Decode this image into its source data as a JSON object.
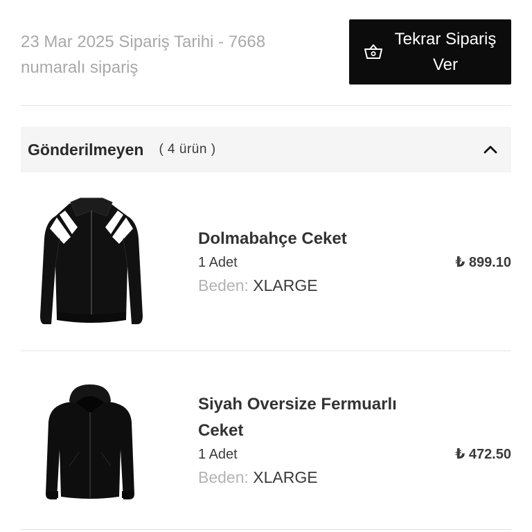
{
  "order": {
    "meta_text": "23 Mar 2025 Sipariş Tarihi - 7668 numaralı sipariş",
    "reorder_label": "Tekrar Sipariş Ver"
  },
  "section": {
    "title": "Gönderilmeyen",
    "count": "( 4 ürün )",
    "toggle_icon": "chevron-up-icon"
  },
  "products": [
    {
      "name": "Dolmabahçe Ceket",
      "quantity": "1 Adet",
      "size_label": "Beden:",
      "size_value": "XLARGE",
      "price": "₺ 899.10",
      "image": "black-track-jacket-with-white-shoulder-stripes"
    },
    {
      "name": "Siyah Oversize Fermuarlı Ceket",
      "quantity": "1 Adet",
      "size_label": "Beden:",
      "size_value": "XLARGE",
      "price": "₺ 472.50",
      "image": "black-hooded-zip-jacket"
    }
  ],
  "colors": {
    "button_bg": "#0c0c0c",
    "section_bg": "#f5f5f6",
    "muted_text": "#a9a9a9"
  }
}
